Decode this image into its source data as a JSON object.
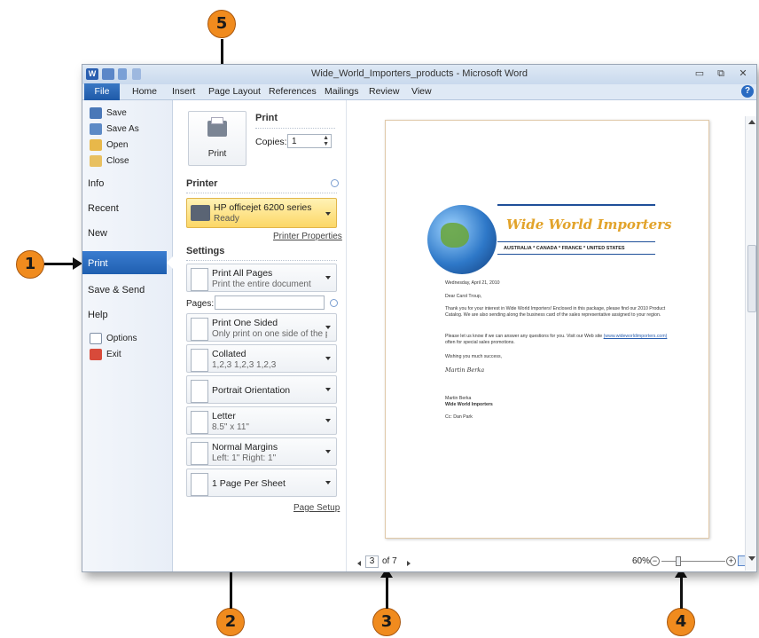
{
  "window": {
    "title": "Wide_World_Importers_products - Microsoft Word",
    "minimize": "▭",
    "restore": "⧉",
    "close": "✕",
    "help": "?"
  },
  "ribbon": {
    "tabs": [
      "File",
      "Home",
      "Insert",
      "Page Layout",
      "References",
      "Mailings",
      "Review",
      "View"
    ]
  },
  "nav": {
    "small": [
      "Save",
      "Save As",
      "Open",
      "Close"
    ],
    "big": [
      "Info",
      "Recent",
      "New",
      "Print",
      "Save & Send",
      "Help"
    ],
    "small2": [
      "Options",
      "Exit"
    ]
  },
  "print": {
    "header": "Print",
    "button": "Print",
    "copies_label": "Copies:",
    "copies_value": "1",
    "printer_header": "Printer",
    "printer_name": "HP officejet 6200 series",
    "printer_status": "Ready",
    "printer_properties": "Printer Properties",
    "settings_header": "Settings",
    "pages_label": "Pages:",
    "pages_value": "",
    "page_setup": "Page Setup",
    "dropdowns": [
      {
        "l1": "Print All Pages",
        "l2": "Print the entire document"
      },
      {
        "l1": "Print One Sided",
        "l2": "Only print on one side of the p..."
      },
      {
        "l1": "Collated",
        "l2": "1,2,3   1,2,3   1,2,3"
      },
      {
        "l1": "Portrait Orientation",
        "l2": ""
      },
      {
        "l1": "Letter",
        "l2": "8.5\" x 11\""
      },
      {
        "l1": "Normal Margins",
        "l2": "Left: 1\"   Right: 1\""
      },
      {
        "l1": "1 Page Per Sheet",
        "l2": ""
      }
    ]
  },
  "preview": {
    "page_current": "3",
    "page_of": "of 7",
    "zoom": "60%",
    "doc": {
      "brand": "Wide World Importers",
      "countries": "AUSTRALIA * CANADA * FRANCE * UNITED STATES",
      "date": "Wednesday, April 21, 2010",
      "greeting": "Dear Carol Troup,",
      "p1": "Thank you for your interest in Wide World Importers! Enclosed in this package, please find our 2010 Product Catalog. We are also sending along the business card of the sales representative assigned to your region.",
      "p2a": "Please let us know if we can answer any questions for you. Visit our Web site",
      "p2link": "(www.wideworldimporters.com)",
      "p2b": " often for special sales promotions.",
      "wish": "Wishing you much success,",
      "signature": "Martin Berka",
      "name": "Martin Berka",
      "company": "Wide World Importers",
      "cc": "Cc: Dan Park"
    }
  },
  "callouts": [
    "1",
    "2",
    "3",
    "4",
    "5"
  ],
  "colors": {
    "accent": "#2a6bc2",
    "callout": "#f08b1e",
    "printer_highlight": "#fde38a"
  }
}
